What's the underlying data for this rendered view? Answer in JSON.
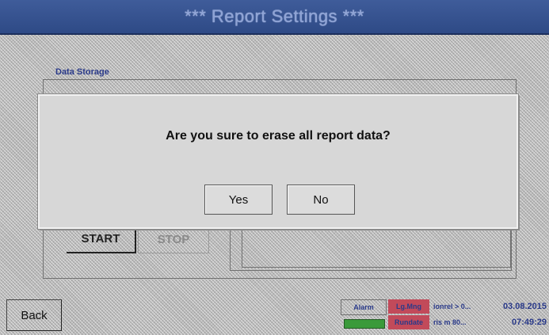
{
  "header": {
    "title": "*** Report Settings ***"
  },
  "background": {
    "section_label": "Data Storage",
    "start_label": "START",
    "stop_label": "STOP"
  },
  "dialog": {
    "message": "Are you sure to erase all report data?",
    "yes_label": "Yes",
    "no_label": "No"
  },
  "footer": {
    "back_label": "Back",
    "alarm_label": "Alarm",
    "status_top": "Lg.Mng",
    "status_bottom": "Rundate",
    "info_top": "ionrel > 0...",
    "info_bottom": "ris m 80...",
    "date": "03.08.2015",
    "time": "07:49:29"
  },
  "colors": {
    "title_bar": "#2e4a86",
    "alarm_indicator": "#3a9a3a",
    "status_badge": "#c24a5a"
  }
}
